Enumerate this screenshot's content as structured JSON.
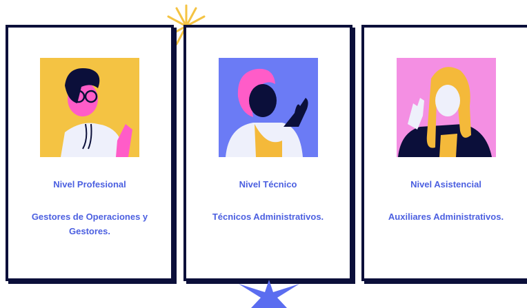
{
  "cards": [
    {
      "level": "Nivel Profesional",
      "roles": "Gestores de Operaciones y Gestores.",
      "illustration": "person-with-glasses-illustration",
      "bg_color": "#f4c343"
    },
    {
      "level": "Nivel Técnico",
      "roles": "Técnicos Administrativos.",
      "illustration": "person-pink-hair-waving-illustration",
      "bg_color": "#6b7bf5"
    },
    {
      "level": "Nivel Asistencial",
      "roles": "Auxiliares Administrativos.",
      "illustration": "person-blonde-hair-waving-illustration",
      "bg_color": "#f48fe3"
    }
  ],
  "decorations": {
    "top_star_color": "#f4c343",
    "bottom_star_color": "#5b6df0"
  },
  "colors": {
    "accent_text": "#4b5fe0",
    "border": "#0b0f3a"
  }
}
